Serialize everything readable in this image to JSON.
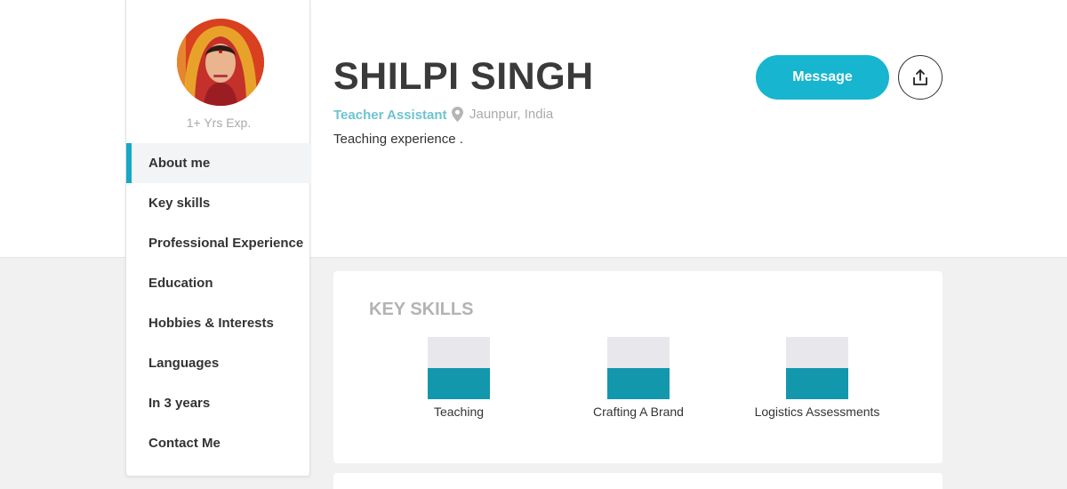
{
  "profile": {
    "name": "SHILPI SINGH",
    "role": "Teacher Assistant",
    "location": "Jaunpur, India",
    "summary": "Teaching experience .",
    "experience": "1+ Yrs Exp."
  },
  "actions": {
    "message_label": "Message",
    "share_icon": "share-icon"
  },
  "nav": {
    "items": [
      {
        "label": "About me",
        "active": true
      },
      {
        "label": "Key skills"
      },
      {
        "label": "Professional Experience"
      },
      {
        "label": "Education"
      },
      {
        "label": "Hobbies & Interests"
      },
      {
        "label": "Languages"
      },
      {
        "label": "In 3 years"
      },
      {
        "label": "Contact Me"
      }
    ]
  },
  "key_skills": {
    "title": "KEY SKILLS",
    "skills": [
      {
        "label": "Teaching",
        "level": 0.5
      },
      {
        "label": "Crafting A Brand",
        "level": 0.5
      },
      {
        "label": "Logistics Assessments",
        "level": 0.5
      }
    ]
  },
  "colors": {
    "accent": "#17b5cf",
    "skill_fill": "#1397ad",
    "role_text": "#6ec3d2"
  }
}
